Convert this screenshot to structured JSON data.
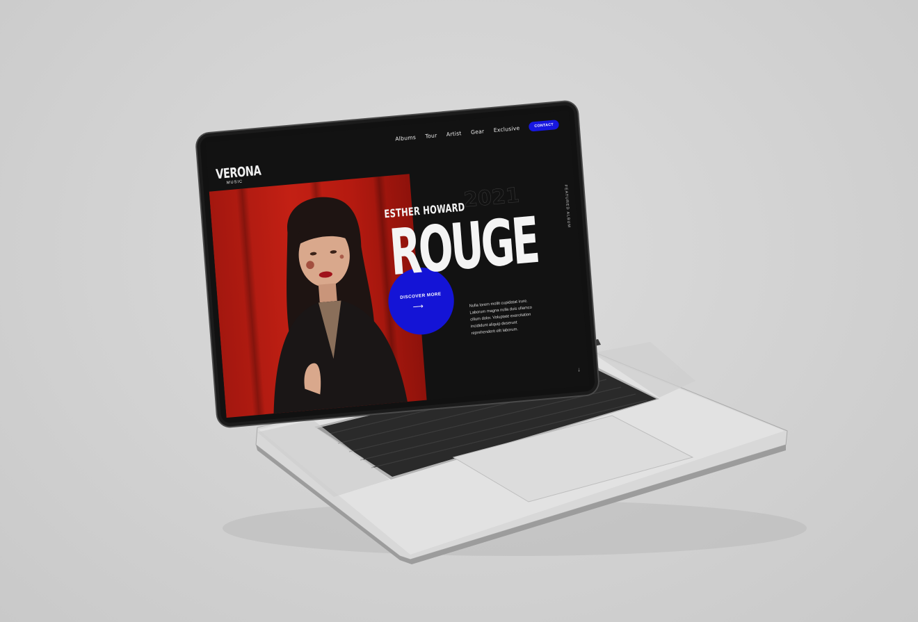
{
  "nav": {
    "items": [
      "Albums",
      "Tour",
      "Artist",
      "Gear",
      "Exclusive"
    ],
    "contact_label": "CONTACT"
  },
  "logo": {
    "word": "VERONA",
    "sub": "MUSIC"
  },
  "hero": {
    "artist": "ESTHER HOWARD",
    "year": "2021",
    "title": "ROUGE",
    "cta_label": "DISCOVER MORE",
    "description": "Nulla lorem mollit cupidatat irure. Laborum magna nulla duis ullamco cillum dolor. Voluptate exercitation incididunt aliquip deserunt reprehenderit elit laborum.",
    "side_label": "FEATURED ALBUM"
  },
  "colors": {
    "accent": "#1414d6",
    "background": "#121212",
    "photo": "#c32014"
  },
  "icons": {
    "cta_arrow": "long-right-arrow-icon",
    "scroll": "down-arrow-icon"
  }
}
